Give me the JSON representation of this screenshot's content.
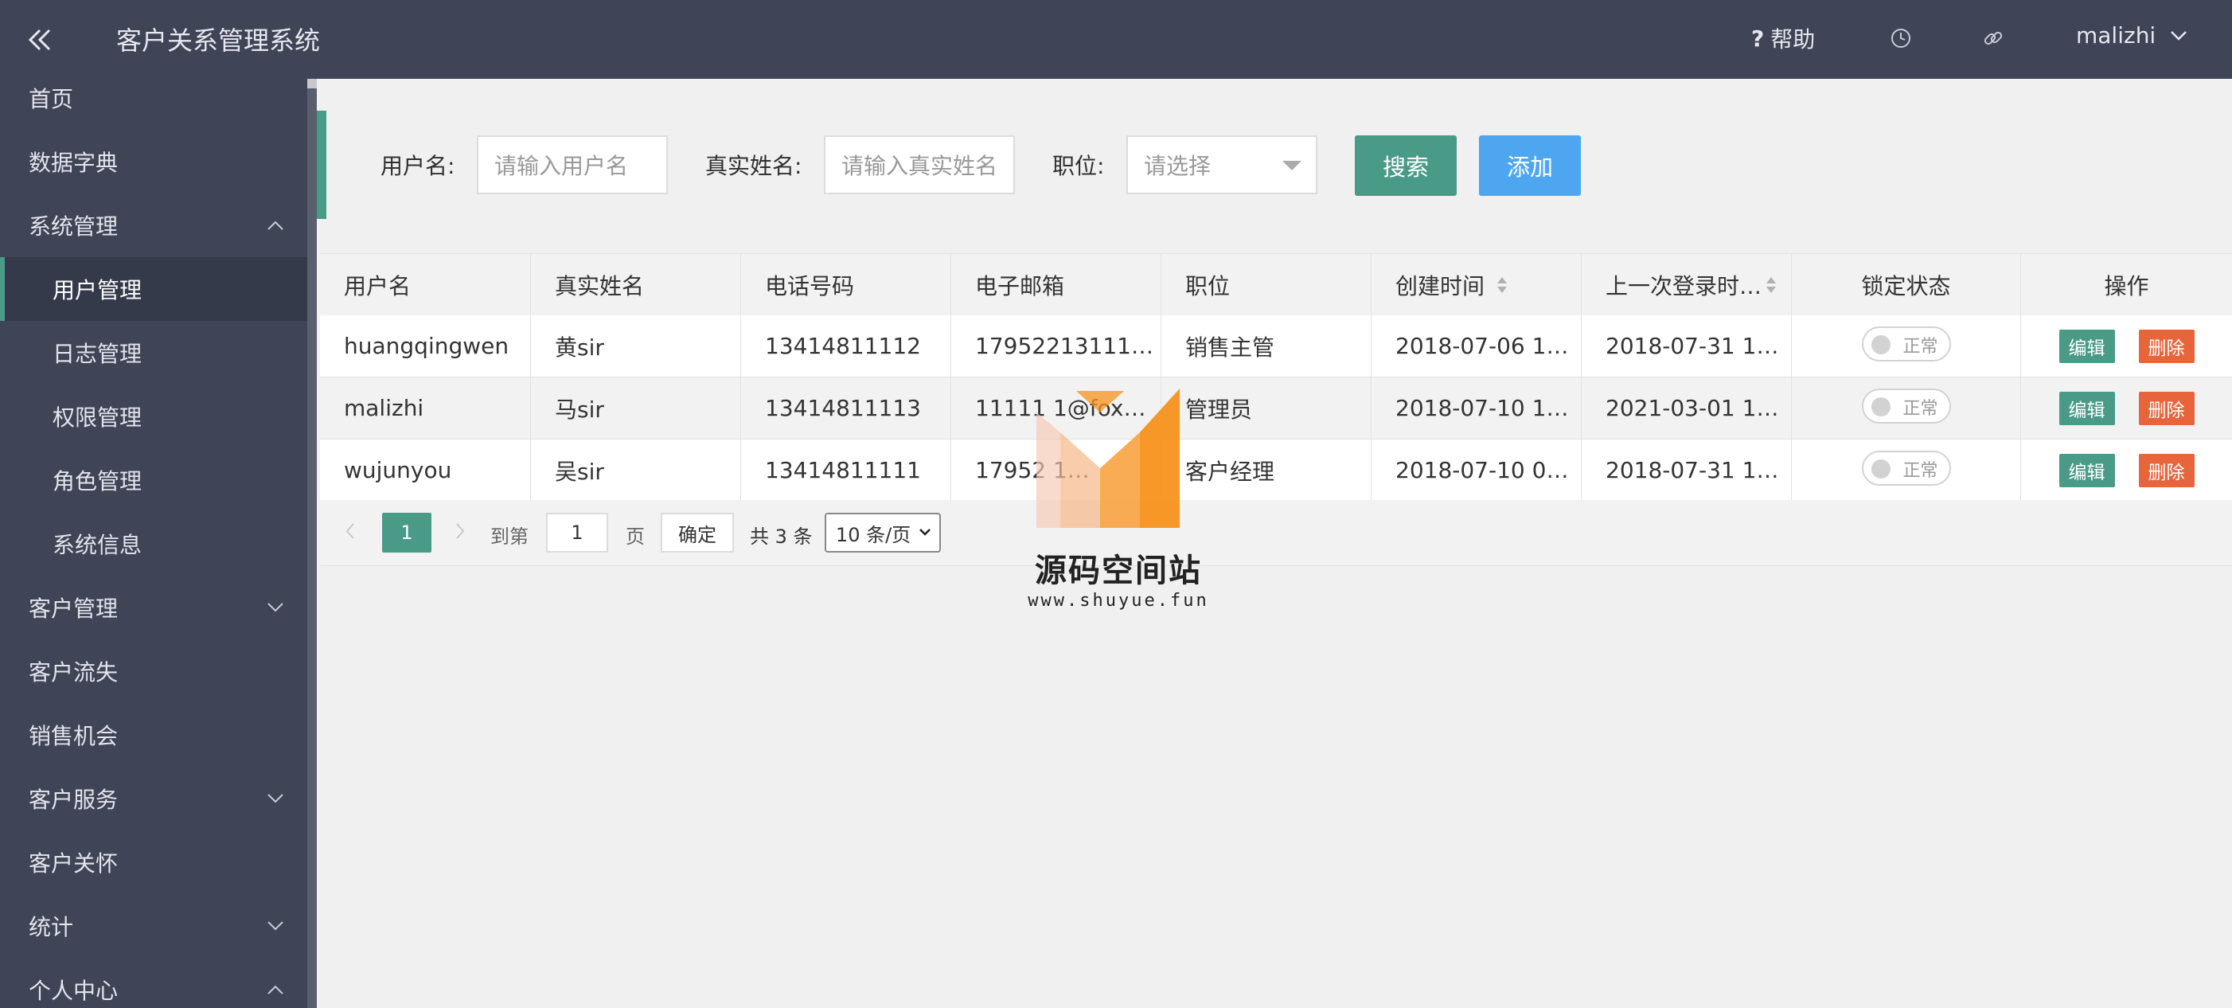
{
  "header": {
    "title": "客户关系管理系统",
    "help_label": "帮助",
    "help_icon": "question-mark-icon",
    "history_icon": "clock-icon",
    "link_icon": "link-icon",
    "username": "malizhi"
  },
  "sidebar": {
    "items": [
      {
        "label": "首页"
      },
      {
        "label": "数据字典"
      },
      {
        "label": "系统管理",
        "expanded": true
      },
      {
        "label": "用户管理",
        "active": true
      },
      {
        "label": "日志管理"
      },
      {
        "label": "权限管理"
      },
      {
        "label": "角色管理"
      },
      {
        "label": "系统信息"
      },
      {
        "label": "客户管理",
        "expandable": true
      },
      {
        "label": "客户流失"
      },
      {
        "label": "销售机会"
      },
      {
        "label": "客户服务",
        "expandable": true
      },
      {
        "label": "客户关怀"
      },
      {
        "label": "统计",
        "expandable": true
      },
      {
        "label": "个人中心",
        "expanded": true
      }
    ]
  },
  "search": {
    "username_label": "用户名:",
    "username_placeholder": "请输入用户名",
    "realname_label": "真实姓名:",
    "realname_placeholder": "请输入真实姓名",
    "position_label": "职位:",
    "position_placeholder": "请选择",
    "search_button": "搜索",
    "add_button": "添加"
  },
  "table": {
    "columns": [
      "用户名",
      "真实姓名",
      "电话号码",
      "电子邮箱",
      "职位",
      "创建时间",
      "上一次登录时…",
      "锁定状态",
      "操作"
    ],
    "rows": [
      {
        "username": "huangqingwen",
        "realname": "黄sir",
        "phone": "13414811112",
        "email": "17952213111…",
        "position": "销售主管",
        "created": "2018-07-06 1…",
        "last_login": "2018-07-31 1…",
        "lock_status": "正常"
      },
      {
        "username": "malizhi",
        "realname": "马sir",
        "phone": "13414811113",
        "email": "11111 1@fox…",
        "position": "管理员",
        "created": "2018-07-10 1…",
        "last_login": "2021-03-01 1…",
        "lock_status": "正常"
      },
      {
        "username": "wujunyou",
        "realname": "吴sir",
        "phone": "13414811111",
        "email": "17952 1…",
        "position": "客户经理",
        "created": "2018-07-10 0…",
        "last_login": "2018-07-31 1…",
        "lock_status": "正常"
      }
    ],
    "edit_label": "编辑",
    "delete_label": "删除"
  },
  "pager": {
    "current_page": "1",
    "goto_label": "到第",
    "goto_value": "1",
    "page_unit": "页",
    "confirm_label": "确定",
    "total_label": "共 3 条",
    "page_size": "10 条/页"
  },
  "watermark": {
    "title": "源码空间站",
    "url": "www.shuyue.fun"
  },
  "colors": {
    "header_bg": "#3f4457",
    "accent_green": "#4a9a88",
    "add_blue": "#4fa6f0",
    "delete_orange": "#e8643b"
  }
}
